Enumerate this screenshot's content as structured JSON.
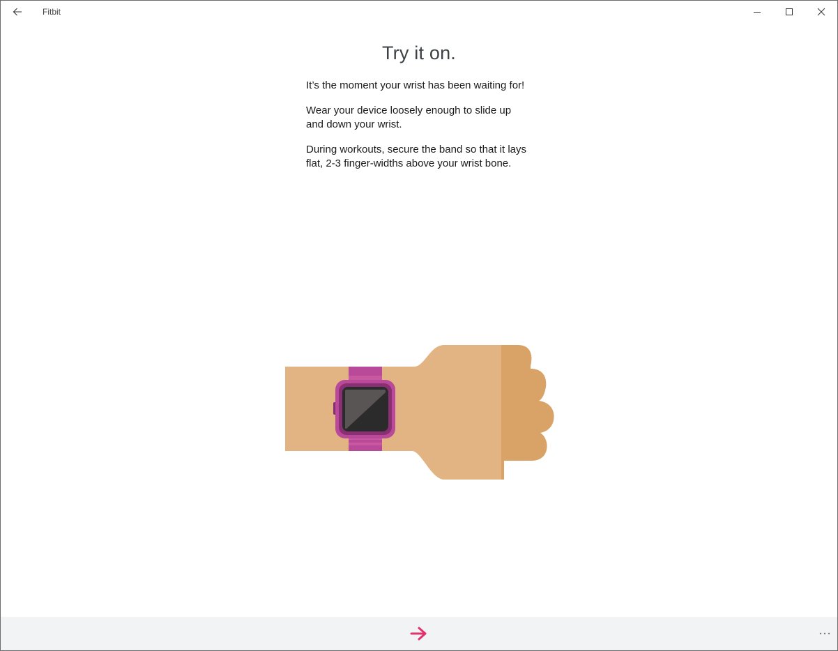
{
  "window": {
    "title": "Fitbit",
    "controls": [
      "minimize",
      "maximize",
      "close"
    ]
  },
  "page": {
    "heading": "Try it on.",
    "paragraphs": [
      "It’s the moment your wrist has been waiting for!",
      "Wear your device loosely enough to slide up and down your wrist.",
      "During workouts, secure the band so that it lays flat, 2-3 finger-widths above your wrist bone."
    ]
  },
  "illustration": {
    "subject": "wrist-with-smartwatch",
    "colors": {
      "skin": "#e2b484",
      "skin_shadow": "#d9a266",
      "band": "#b94a9a",
      "band_stripe": "#c9589f",
      "case": "#8a2f74",
      "screen": "#2b2b2b",
      "screen_glare": "#4a4a4a"
    }
  },
  "bottombar": {
    "next_icon": "arrow-right-icon",
    "more_icon": "ellipsis-icon",
    "accent": "#e0336b"
  }
}
